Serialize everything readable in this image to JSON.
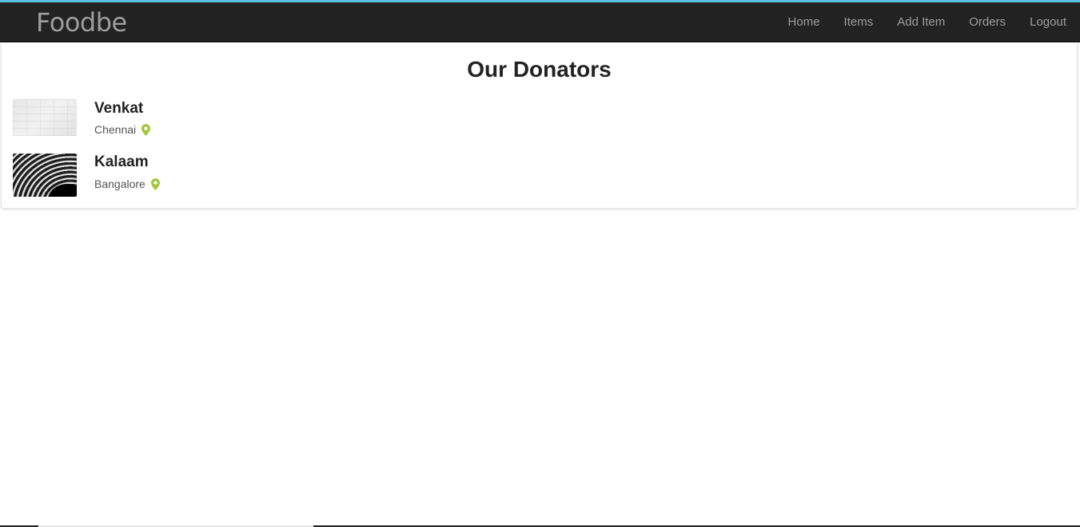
{
  "navbar": {
    "brand": "Foodbe",
    "links": [
      {
        "label": "Home"
      },
      {
        "label": "Items"
      },
      {
        "label": "Add Item"
      },
      {
        "label": "Orders"
      },
      {
        "label": "Logout"
      }
    ]
  },
  "main": {
    "heading": "Our Donators",
    "donors": [
      {
        "name": "Venkat",
        "location": "Chennai",
        "location_icon": "map-marker-icon"
      },
      {
        "name": "Kalaam",
        "location": "Bangalore",
        "location_icon": "map-marker-icon"
      }
    ]
  },
  "colors": {
    "navbar_bg": "#222222",
    "nav_text": "#9d9d9d",
    "pin": "#a4c639",
    "accent_top": "#5bc0de"
  }
}
